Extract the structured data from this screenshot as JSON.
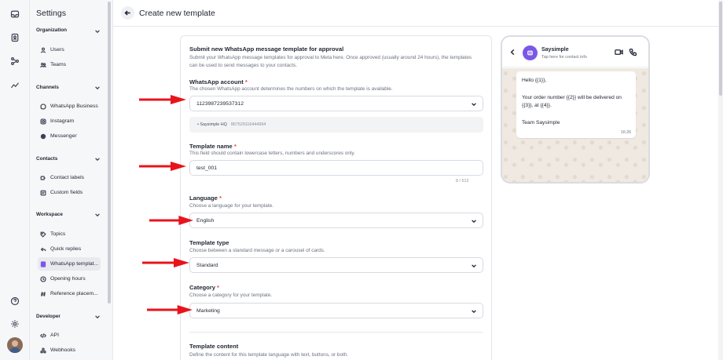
{
  "sidebar": {
    "title": "Settings",
    "sections": [
      {
        "label": "Organization",
        "items": [
          {
            "label": "Users",
            "icon": "user-icon"
          },
          {
            "label": "Teams",
            "icon": "team-icon"
          }
        ]
      },
      {
        "label": "Channels",
        "items": [
          {
            "label": "WhatsApp Business",
            "icon": "whatsapp-icon"
          },
          {
            "label": "Instagram",
            "icon": "instagram-icon"
          },
          {
            "label": "Messenger",
            "icon": "messenger-icon"
          }
        ]
      },
      {
        "label": "Contacts",
        "items": [
          {
            "label": "Contact labels",
            "icon": "label-icon"
          },
          {
            "label": "Custom fields",
            "icon": "custom-fields-icon"
          }
        ]
      },
      {
        "label": "Workspace",
        "items": [
          {
            "label": "Topics",
            "icon": "tag-icon"
          },
          {
            "label": "Quick replies",
            "icon": "quick-reply-icon"
          },
          {
            "label": "WhatsApp templat...",
            "icon": "template-icon",
            "active": true
          },
          {
            "label": "Opening hours",
            "icon": "clock-icon"
          },
          {
            "label": "Reference placem...",
            "icon": "hash-icon"
          }
        ]
      },
      {
        "label": "Developer",
        "items": [
          {
            "label": "API",
            "icon": "code-icon"
          },
          {
            "label": "Webhooks",
            "icon": "webhook-icon"
          }
        ]
      }
    ]
  },
  "header": {
    "title": "Create new template"
  },
  "form": {
    "heading": "Submit new WhatsApp message template for approval",
    "intro": "Submit your WhatsApp message templates for approval to Meta here. Once approved (usually around 24 hours), the templates can be used to send messages to your contacts.",
    "account": {
      "label": "WhatsApp account",
      "required": "*",
      "description": "The chosen WhatsApp account determines the numbers on which the template is available.",
      "value": "1123987239537312",
      "detail_name": "Saysimple HQ",
      "detail_number": "867529116444994"
    },
    "name": {
      "label": "Template name",
      "required": "*",
      "description": "This field should contain lowercase letters, numbers and underscores only.",
      "value": "test_001",
      "counter": "8 / 512"
    },
    "language": {
      "label": "Language",
      "required": "*",
      "description": "Choose a language for your template.",
      "value": "English"
    },
    "type": {
      "label": "Template type",
      "required": "",
      "description": "Choose between a standard message or a carousel of cards.",
      "value": "Standard"
    },
    "category": {
      "label": "Category",
      "required": "*",
      "description": "Choose a category for your template.",
      "value": "Marketing"
    },
    "content": {
      "label": "Template content",
      "description": "Define the content for this template language with text, buttons, or both."
    }
  },
  "preview": {
    "contact_name": "Saysimple",
    "contact_sub": "Tap here for contact info",
    "lines": [
      "Hello {{1}},",
      "Your order number {{2}} will be delivered on {{3}}, at {{4}}.",
      "Team Saysimple"
    ],
    "time": "16:26"
  },
  "colors": {
    "accent": "#7b57e8",
    "arrow": "#e8141c",
    "required": "#e5484d"
  }
}
